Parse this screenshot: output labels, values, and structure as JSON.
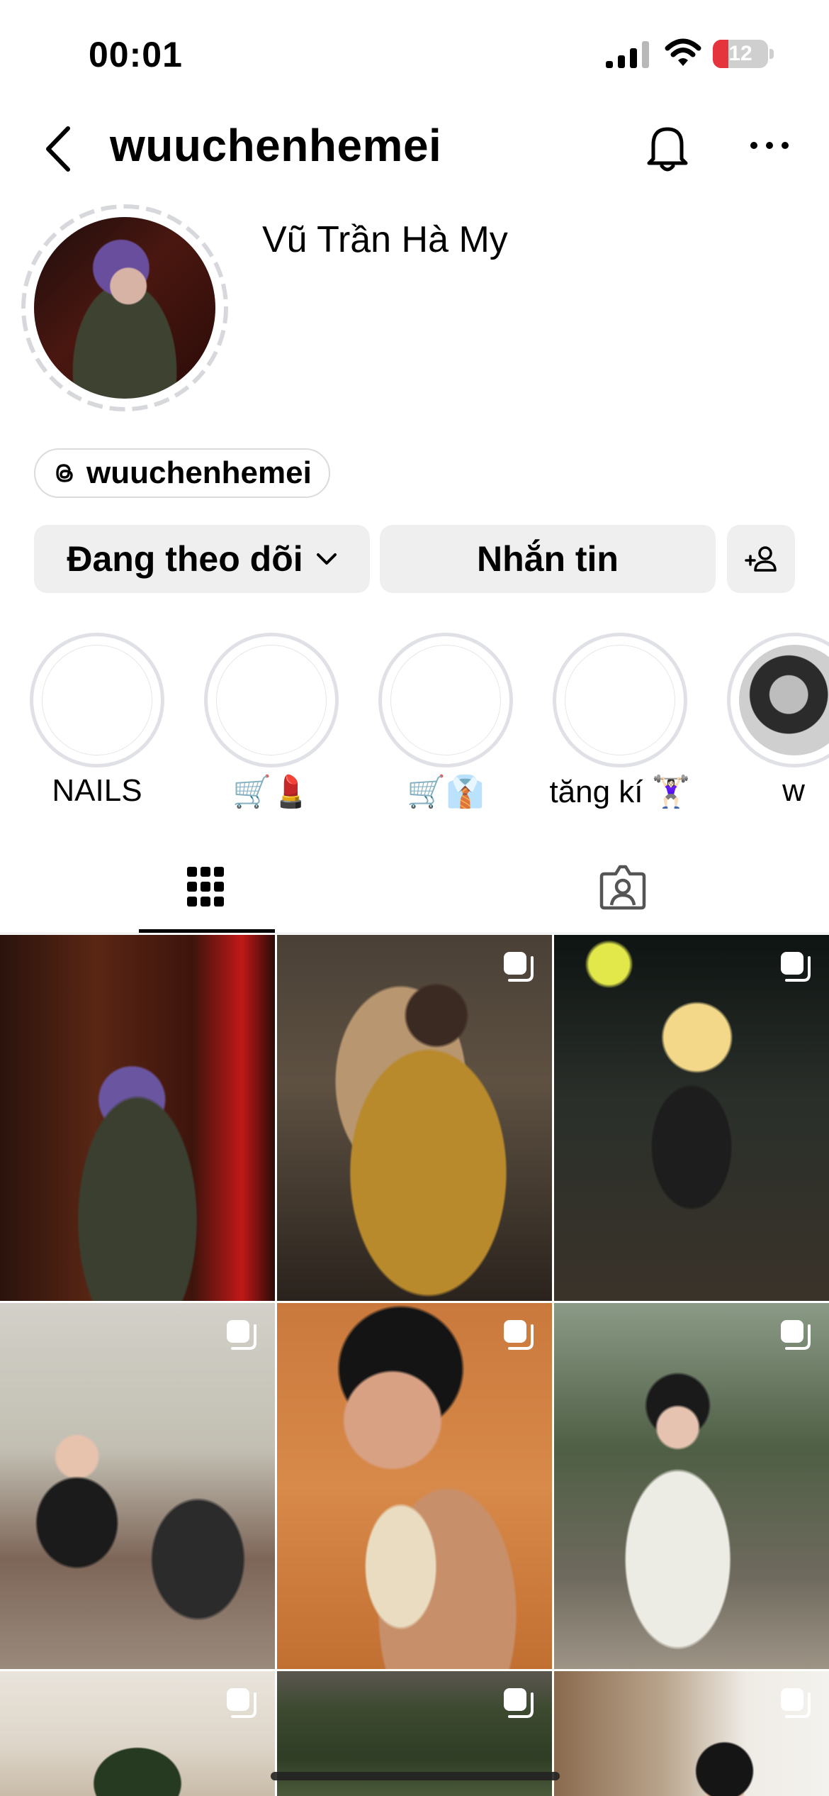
{
  "status_bar": {
    "time": "00:01",
    "battery": "12"
  },
  "header": {
    "username": "wuuchenhemei"
  },
  "profile": {
    "full_name": "Vũ Trần Hà My",
    "threads_handle": "wuuchenhemei"
  },
  "actions": {
    "following_label": "Đang theo dõi",
    "message_label": "Nhắn tin"
  },
  "highlights": [
    {
      "label": "NAILS"
    },
    {
      "label": "🛒💄"
    },
    {
      "label": "🛒👔"
    },
    {
      "label": "tăng kí 🏋🏻‍♀️"
    },
    {
      "label": "w"
    }
  ],
  "tabs": [
    {
      "name": "posts-grid",
      "icon": "grid-icon",
      "active": true
    },
    {
      "name": "tagged",
      "icon": "tagged-person-icon",
      "active": false
    }
  ],
  "posts": [
    {
      "description": "dark bar portrait with fur coat",
      "multi": false
    },
    {
      "description": "mustard ao dai on armchair",
      "multi": true
    },
    {
      "description": "night street blonde bob",
      "multi": true
    },
    {
      "description": "friends selfie in room",
      "multi": true
    },
    {
      "description": "portrait with white snake",
      "multi": true
    },
    {
      "description": "white ao dai by lake",
      "multi": true
    },
    {
      "description": "christmas tree room",
      "multi": true
    },
    {
      "description": "hillside greenery",
      "multi": true
    },
    {
      "description": "city portrait",
      "multi": true
    }
  ],
  "colors": {
    "button_bg": "#efefef",
    "ring": "#dfe1e6",
    "battery_low": "#e5343c"
  }
}
